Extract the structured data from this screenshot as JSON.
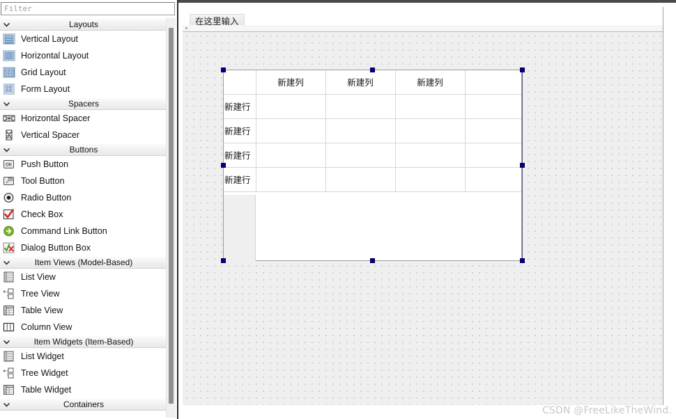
{
  "window": {
    "watermark": "CSDN @FreeLikeTheWind."
  },
  "sidebar": {
    "filter": {
      "value": "",
      "placeholder": "Filter"
    },
    "scrollbar": {
      "name": "widget-box-scrollbar"
    },
    "sections": [
      {
        "title": "Layouts",
        "expanded": true,
        "items": [
          {
            "label": "Vertical Layout",
            "icon": "vertical-layout-icon"
          },
          {
            "label": "Horizontal Layout",
            "icon": "horizontal-layout-icon"
          },
          {
            "label": "Grid Layout",
            "icon": "grid-layout-icon"
          },
          {
            "label": "Form Layout",
            "icon": "form-layout-icon"
          }
        ]
      },
      {
        "title": "Spacers",
        "expanded": true,
        "items": [
          {
            "label": "Horizontal Spacer",
            "icon": "horizontal-spacer-icon"
          },
          {
            "label": "Vertical Spacer",
            "icon": "vertical-spacer-icon"
          }
        ]
      },
      {
        "title": "Buttons",
        "expanded": true,
        "items": [
          {
            "label": "Push Button",
            "icon": "push-button-icon"
          },
          {
            "label": "Tool Button",
            "icon": "tool-button-icon"
          },
          {
            "label": "Radio Button",
            "icon": "radio-button-icon"
          },
          {
            "label": "Check Box",
            "icon": "check-box-icon"
          },
          {
            "label": "Command Link Button",
            "icon": "command-link-button-icon"
          },
          {
            "label": "Dialog Button Box",
            "icon": "dialog-button-box-icon"
          }
        ]
      },
      {
        "title": "Item Views (Model-Based)",
        "expanded": true,
        "items": [
          {
            "label": "List View",
            "icon": "list-view-icon"
          },
          {
            "label": "Tree View",
            "icon": "tree-view-icon"
          },
          {
            "label": "Table View",
            "icon": "table-view-icon"
          },
          {
            "label": "Column View",
            "icon": "column-view-icon"
          }
        ]
      },
      {
        "title": "Item Widgets (Item-Based)",
        "expanded": true,
        "items": [
          {
            "label": "List Widget",
            "icon": "list-widget-icon"
          },
          {
            "label": "Tree Widget",
            "icon": "tree-widget-icon"
          },
          {
            "label": "Table Widget",
            "icon": "table-widget-icon"
          }
        ]
      },
      {
        "title": "Containers",
        "expanded": true,
        "items": []
      }
    ]
  },
  "editor": {
    "menubar": {
      "type_here_label": "在这里输入"
    },
    "table_widget": {
      "corner_label": "",
      "column_headers": [
        "",
        "新建列",
        "新建列",
        "新建列",
        ""
      ],
      "row_headers": [
        "新建行",
        "新建行",
        "新建行",
        "新建行"
      ],
      "rows": [
        [
          "",
          "",
          "",
          ""
        ],
        [
          "",
          "",
          "",
          ""
        ],
        [
          "",
          "",
          "",
          ""
        ],
        [
          "",
          "",
          "",
          ""
        ]
      ],
      "selected": true,
      "selection_handles": 8
    }
  }
}
